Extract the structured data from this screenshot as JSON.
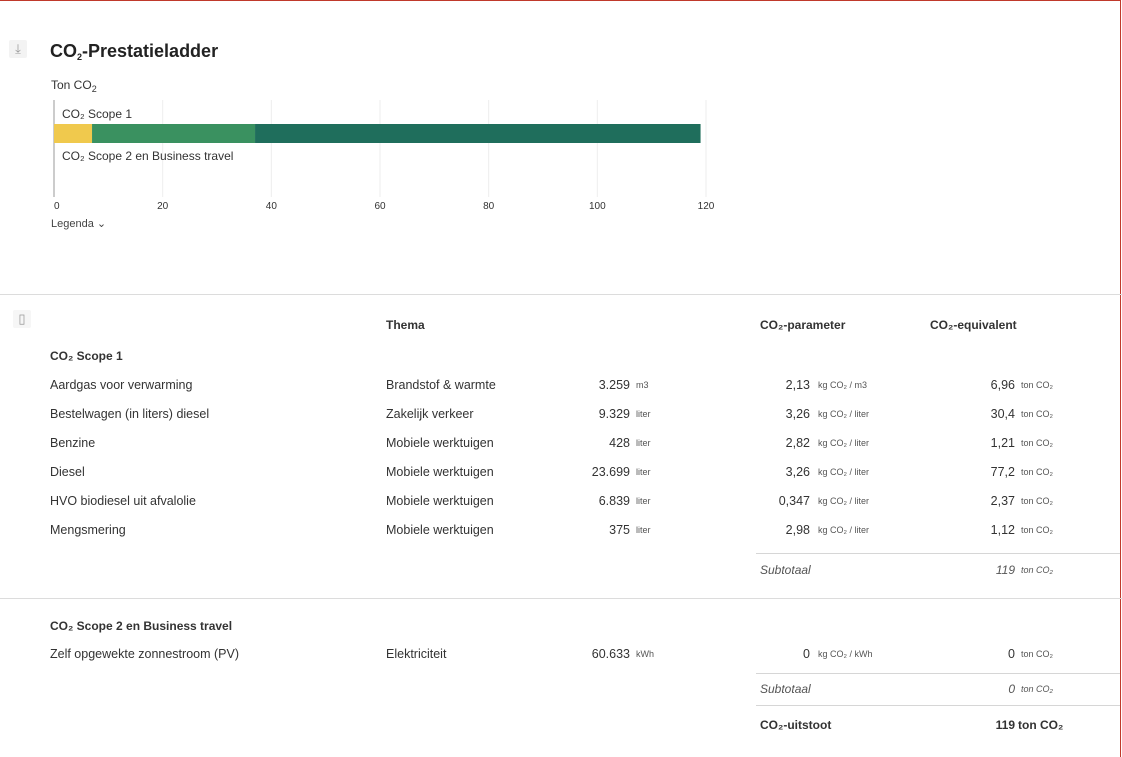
{
  "header": {
    "title_main": "CO",
    "title_sub": "2",
    "title_rest": "-Prestatieladder",
    "download_icon": "download-icon"
  },
  "chart_data": {
    "type": "bar",
    "orientation": "horizontal",
    "stacked": true,
    "ylabel_main": "Ton CO",
    "ylabel_sub": "2",
    "categories": [
      "CO₂ Scope 1",
      "CO₂ Scope 2 en Business travel"
    ],
    "series": [
      {
        "color": "#f0c94d",
        "values": [
          7,
          0
        ]
      },
      {
        "color": "#3a9160",
        "values": [
          30,
          0
        ]
      },
      {
        "color": "#1f6e5c",
        "values": [
          82,
          0
        ]
      }
    ],
    "xlim": [
      0,
      120
    ],
    "xticks": [
      "0",
      "20",
      "40",
      "60",
      "80",
      "100",
      "120"
    ],
    "grid": true
  },
  "legend_toggle": "Legenda",
  "table": {
    "copy_icon": "clipboard-icon",
    "col_thema": "Thema",
    "col_param": "CO₂-parameter",
    "col_equiv": "CO₂-equivalent",
    "scope1": {
      "heading": "CO₂ Scope 1",
      "rows": [
        {
          "name": "Aardgas voor verwarming",
          "thema": "Brandstof & warmte",
          "qty": "3.259",
          "qty_unit": "m3",
          "param": "2,13",
          "param_unit": "kg CO₂ / m3",
          "equiv": "6,96",
          "equiv_unit": "ton CO₂"
        },
        {
          "name": "Bestelwagen (in liters) diesel",
          "thema": "Zakelijk verkeer",
          "qty": "9.329",
          "qty_unit": "liter",
          "param": "3,26",
          "param_unit": "kg CO₂ / liter",
          "equiv": "30,4",
          "equiv_unit": "ton CO₂"
        },
        {
          "name": "Benzine",
          "thema": "Mobiele werktuigen",
          "qty": "428",
          "qty_unit": "liter",
          "param": "2,82",
          "param_unit": "kg CO₂ / liter",
          "equiv": "1,21",
          "equiv_unit": "ton CO₂"
        },
        {
          "name": "Diesel",
          "thema": "Mobiele werktuigen",
          "qty": "23.699",
          "qty_unit": "liter",
          "param": "3,26",
          "param_unit": "kg CO₂ / liter",
          "equiv": "77,2",
          "equiv_unit": "ton CO₂"
        },
        {
          "name": "HVO biodiesel uit afvalolie",
          "thema": "Mobiele werktuigen",
          "qty": "6.839",
          "qty_unit": "liter",
          "param": "0,347",
          "param_unit": "kg CO₂ / liter",
          "equiv": "2,37",
          "equiv_unit": "ton CO₂"
        },
        {
          "name": "Mengsmering",
          "thema": "Mobiele werktuigen",
          "qty": "375",
          "qty_unit": "liter",
          "param": "2,98",
          "param_unit": "kg CO₂ / liter",
          "equiv": "1,12",
          "equiv_unit": "ton CO₂"
        }
      ],
      "subtotal_label": "Subtotaal",
      "subtotal_value": "119",
      "subtotal_unit": "ton CO₂"
    },
    "scope2": {
      "heading": "CO₂ Scope 2 en Business travel",
      "rows": [
        {
          "name": "Zelf opgewekte zonnestroom (PV)",
          "thema": "Elektriciteit",
          "qty": "60.633",
          "qty_unit": "kWh",
          "param": "0",
          "param_unit": "kg CO₂ / kWh",
          "equiv": "0",
          "equiv_unit": "ton CO₂"
        }
      ],
      "subtotal_label": "Subtotaal",
      "subtotal_value": "0",
      "subtotal_unit": "ton CO₂"
    },
    "total_label": "CO₂-uitstoot",
    "total_value": "119",
    "total_unit": "ton CO₂"
  }
}
